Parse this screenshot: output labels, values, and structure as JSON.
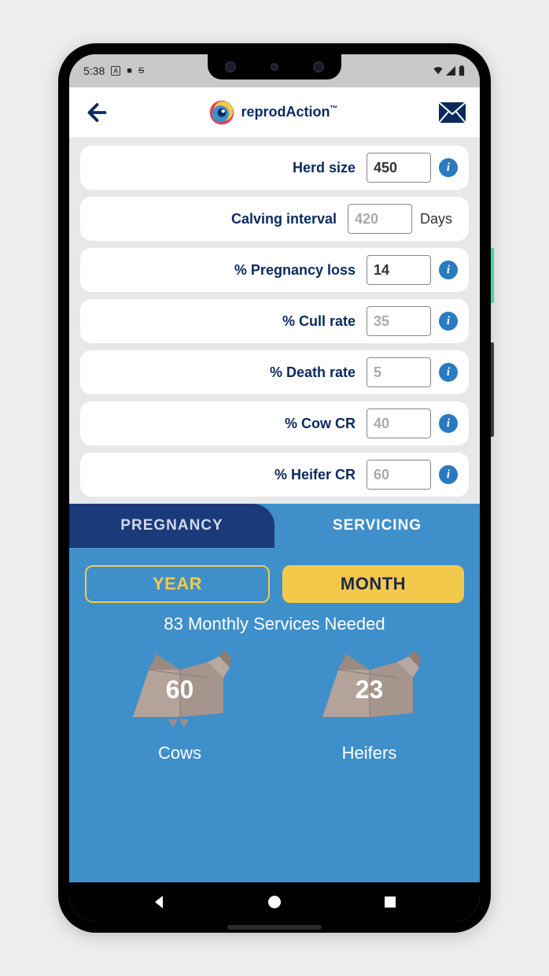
{
  "status": {
    "time": "5:38",
    "icons": [
      "A",
      "■",
      "S"
    ]
  },
  "header": {
    "brand_prefix": "reprod",
    "brand_accent": "Action",
    "brand_suffix": "™"
  },
  "form": {
    "rows": [
      {
        "label": "Herd size",
        "value": "450",
        "muted": false,
        "trailing": "info"
      },
      {
        "label": "Calving interval",
        "value": "420",
        "muted": true,
        "trailing": "unit",
        "unit": "Days"
      },
      {
        "label": "% Pregnancy loss",
        "value": "14",
        "muted": false,
        "trailing": "info"
      },
      {
        "label": "% Cull rate",
        "value": "35",
        "muted": true,
        "trailing": "info"
      },
      {
        "label": "% Death rate",
        "value": "5",
        "muted": true,
        "trailing": "info"
      },
      {
        "label": "% Cow CR",
        "value": "40",
        "muted": true,
        "trailing": "info"
      },
      {
        "label": "% Heifer CR",
        "value": "60",
        "muted": true,
        "trailing": "info"
      }
    ]
  },
  "results": {
    "tabs": {
      "left": "PREGNANCY",
      "right": "SERVICING",
      "active": "right"
    },
    "period": {
      "year": "YEAR",
      "month": "MONTH",
      "active": "month"
    },
    "summary": "83 Monthly Services Needed",
    "animals": [
      {
        "count": "60",
        "label": "Cows",
        "type": "cow"
      },
      {
        "count": "23",
        "label": "Heifers",
        "type": "heifer"
      }
    ]
  },
  "colors": {
    "navy": "#0a2a5e",
    "panel_blue": "#3f8fcb",
    "tab_dark": "#1a3a7a",
    "gold": "#f3c94b",
    "info": "#2a7abf"
  }
}
